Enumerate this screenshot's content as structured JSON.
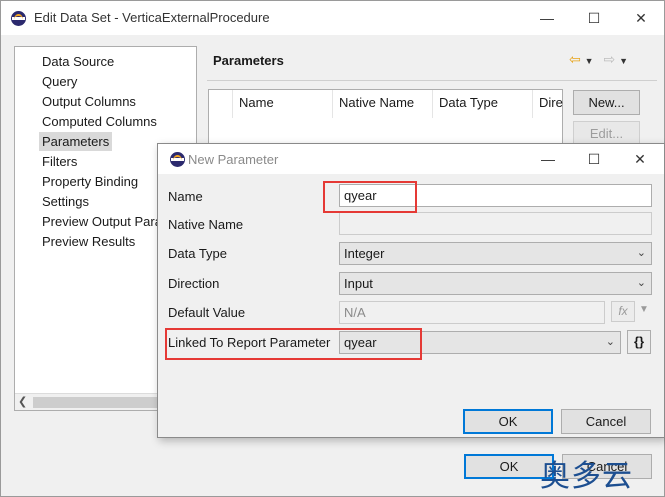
{
  "outer": {
    "title": "Edit Data Set - VerticaExternalProcedure",
    "page_title": "Parameters",
    "tree_items": [
      {
        "label": "Data Source"
      },
      {
        "label": "Query"
      },
      {
        "label": "Output Columns"
      },
      {
        "label": "Computed Columns"
      },
      {
        "label": "Parameters",
        "selected": true
      },
      {
        "label": "Filters"
      },
      {
        "label": "Property Binding"
      },
      {
        "label": "Settings"
      },
      {
        "label": "Preview Output Para"
      },
      {
        "label": "Preview Results"
      }
    ],
    "table_headers": [
      "Name",
      "Native Name",
      "Data Type",
      "Dire"
    ],
    "new_button": "New...",
    "edit_button": "Edit...",
    "ok_button": "OK",
    "cancel_button": "Cancel"
  },
  "dialog": {
    "title": "New Parameter",
    "name_label": "Name",
    "name_value": "qyear",
    "native_name_label": "Native Name",
    "native_name_value": "",
    "data_type_label": "Data Type",
    "data_type_value": "Integer",
    "direction_label": "Direction",
    "direction_value": "Input",
    "default_value_label": "Default Value",
    "default_value_value": "N/A",
    "linked_label": "Linked To Report Parameter",
    "linked_value": "qyear",
    "fx_label": "fx",
    "braces_label": "{}",
    "ok_button": "OK",
    "cancel_button": "Cancel"
  },
  "watermark": "奥多云",
  "colors": {
    "accent": "#0078d7",
    "highlight_box": "#e53935",
    "back_arrow": "#e8a317"
  }
}
